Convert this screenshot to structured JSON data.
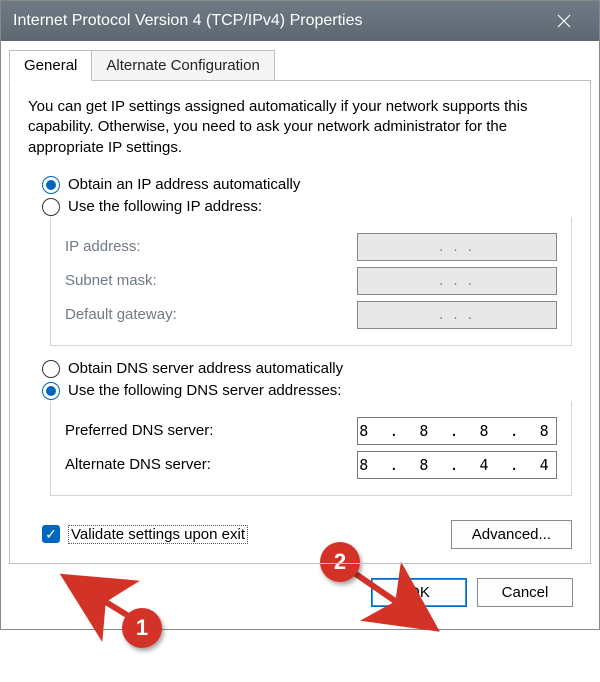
{
  "titlebar": {
    "title": "Internet Protocol Version 4 (TCP/IPv4) Properties"
  },
  "tabs": {
    "general": "General",
    "alternate": "Alternate Configuration"
  },
  "intro": "You can get IP settings assigned automatically if your network supports this capability. Otherwise, you need to ask your network administrator for the appropriate IP settings.",
  "ip": {
    "auto_label": "Obtain an IP address automatically",
    "manual_label": "Use the following IP address:",
    "selected": "auto",
    "fields": {
      "address_label": "IP address:",
      "address_value": ".       .       .",
      "mask_label": "Subnet mask:",
      "mask_value": ".       .       .",
      "gateway_label": "Default gateway:",
      "gateway_value": ".       .       ."
    }
  },
  "dns": {
    "auto_label": "Obtain DNS server address automatically",
    "manual_label": "Use the following DNS server addresses:",
    "selected": "manual",
    "fields": {
      "preferred_label": "Preferred DNS server:",
      "preferred_value": "8 . 8 . 8 . 8",
      "alternate_label": "Alternate DNS server:",
      "alternate_value": "8 . 8 . 4 . 4"
    }
  },
  "validate": {
    "label": "Validate settings upon exit",
    "checked": true
  },
  "buttons": {
    "advanced": "Advanced...",
    "ok": "OK",
    "cancel": "Cancel"
  },
  "annotations": {
    "one": "1",
    "two": "2"
  }
}
